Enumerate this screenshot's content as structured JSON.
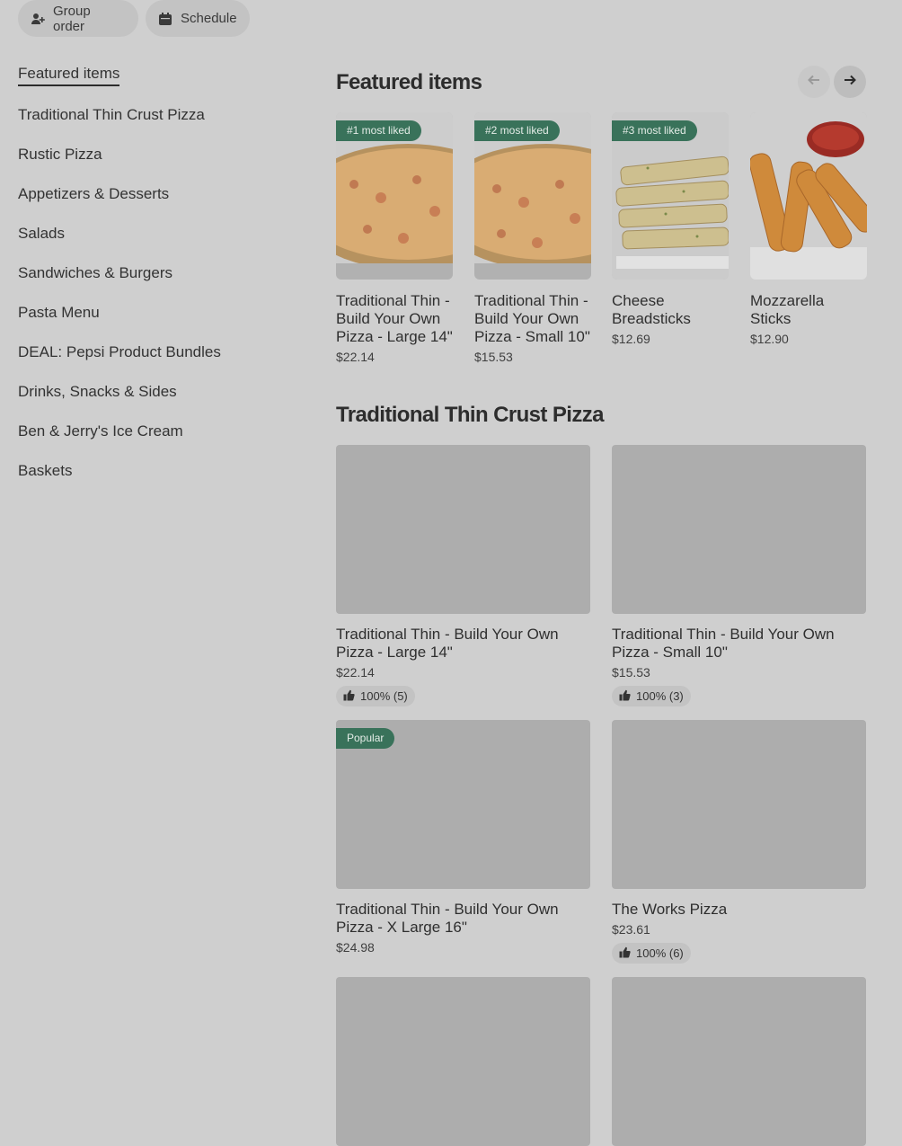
{
  "top_actions": {
    "group_order": "Group order",
    "schedule": "Schedule"
  },
  "sidebar": {
    "items": [
      {
        "label": "Featured items",
        "active": true
      },
      {
        "label": "Traditional Thin Crust Pizza"
      },
      {
        "label": "Rustic Pizza"
      },
      {
        "label": "Appetizers & Desserts"
      },
      {
        "label": "Salads"
      },
      {
        "label": "Sandwiches & Burgers"
      },
      {
        "label": "Pasta Menu"
      },
      {
        "label": "DEAL: Pepsi Product Bundles"
      },
      {
        "label": "Drinks, Snacks & Sides"
      },
      {
        "label": "Ben & Jerry's Ice Cream"
      },
      {
        "label": "Baskets"
      }
    ]
  },
  "featured": {
    "title": "Featured items",
    "items": [
      {
        "badge": "#1 most liked",
        "name": "Traditional Thin - Build Your Own Pizza - Large 14\"",
        "price": "$22.14",
        "image": "pizza"
      },
      {
        "badge": "#2 most liked",
        "name": "Traditional Thin - Build Your Own Pizza - Small 10\"",
        "price": "$15.53",
        "image": "pizza"
      },
      {
        "badge": "#3 most liked",
        "name": "Cheese Breadsticks",
        "price": "$12.69",
        "image": "breadsticks"
      },
      {
        "badge": "",
        "name": "Mozzarella Sticks",
        "price": "$12.90",
        "image": "mozzarella-sticks"
      }
    ]
  },
  "section": {
    "title": "Traditional Thin Crust Pizza",
    "items": [
      {
        "name": "Traditional Thin - Build Your Own Pizza - Large 14\"",
        "price": "$22.14",
        "rating": "100% (5)",
        "badge": ""
      },
      {
        "name": "Traditional Thin - Build Your Own Pizza - Small 10\"",
        "price": "$15.53",
        "rating": "100% (3)",
        "badge": ""
      },
      {
        "name": "Traditional Thin - Build Your Own Pizza - X Large 16\"",
        "price": "$24.98",
        "rating": "",
        "badge": "Popular"
      },
      {
        "name": "The Works Pizza",
        "price": "$23.61",
        "rating": "100% (6)",
        "badge": ""
      }
    ]
  },
  "colors": {
    "page_bg": "#cfcfcf",
    "badge_green": "#39725a",
    "placeholder_gray": "#adadad"
  }
}
